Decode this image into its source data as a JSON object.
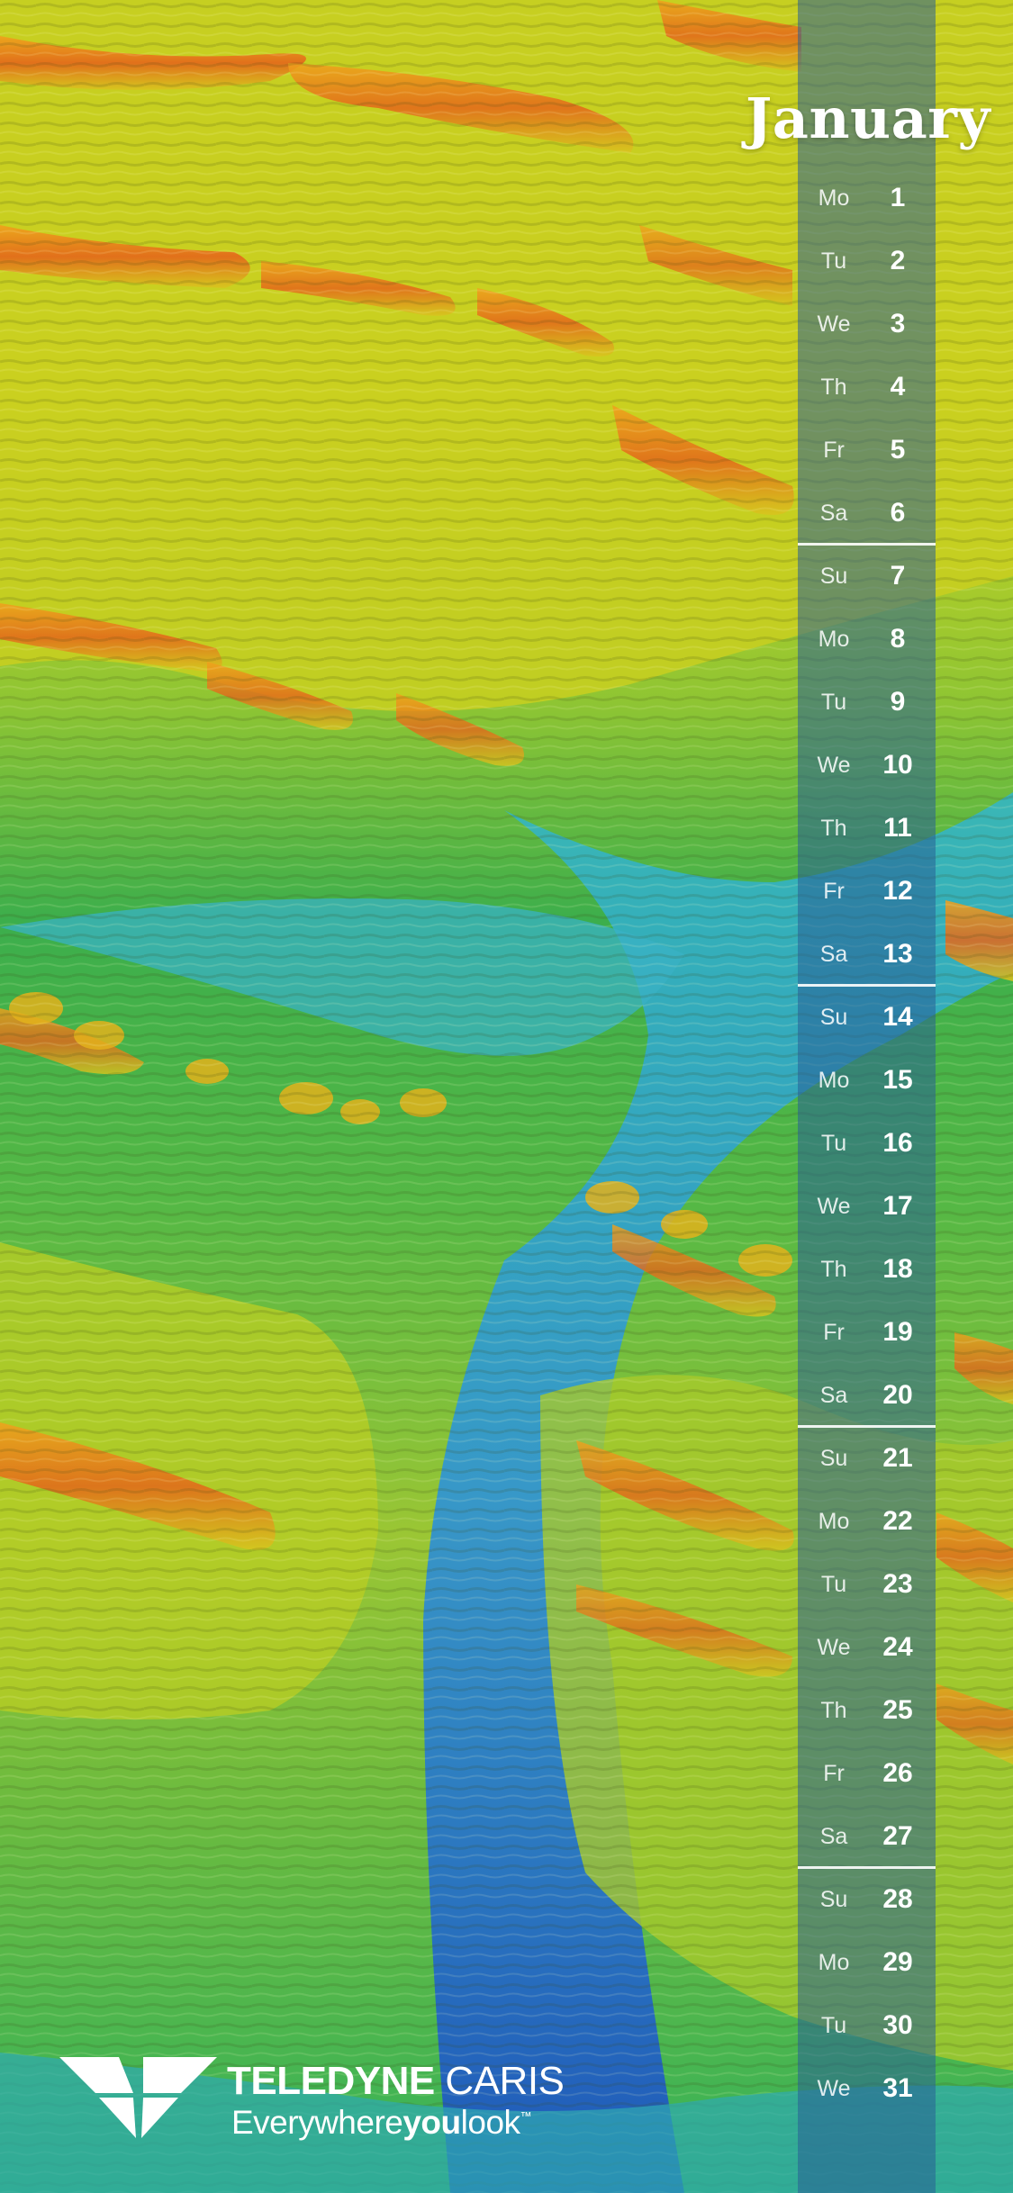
{
  "calendar": {
    "month": "January",
    "days": [
      {
        "dow": "Mo",
        "day": "1"
      },
      {
        "dow": "Tu",
        "day": "2"
      },
      {
        "dow": "We",
        "day": "3"
      },
      {
        "dow": "Th",
        "day": "4"
      },
      {
        "dow": "Fr",
        "day": "5"
      },
      {
        "dow": "Sa",
        "day": "6"
      },
      {
        "dow": "Su",
        "day": "7"
      },
      {
        "dow": "Mo",
        "day": "8"
      },
      {
        "dow": "Tu",
        "day": "9"
      },
      {
        "dow": "We",
        "day": "10"
      },
      {
        "dow": "Th",
        "day": "11"
      },
      {
        "dow": "Fr",
        "day": "12"
      },
      {
        "dow": "Sa",
        "day": "13"
      },
      {
        "dow": "Su",
        "day": "14"
      },
      {
        "dow": "Mo",
        "day": "15"
      },
      {
        "dow": "Tu",
        "day": "16"
      },
      {
        "dow": "We",
        "day": "17"
      },
      {
        "dow": "Th",
        "day": "18"
      },
      {
        "dow": "Fr",
        "day": "19"
      },
      {
        "dow": "Sa",
        "day": "20"
      },
      {
        "dow": "Su",
        "day": "21"
      },
      {
        "dow": "Mo",
        "day": "22"
      },
      {
        "dow": "Tu",
        "day": "23"
      },
      {
        "dow": "We",
        "day": "24"
      },
      {
        "dow": "Th",
        "day": "25"
      },
      {
        "dow": "Fr",
        "day": "26"
      },
      {
        "dow": "Sa",
        "day": "27"
      },
      {
        "dow": "Su",
        "day": "28"
      },
      {
        "dow": "Mo",
        "day": "29"
      },
      {
        "dow": "Tu",
        "day": "30"
      },
      {
        "dow": "We",
        "day": "31"
      }
    ]
  },
  "brand": {
    "name_bold": "TELEDYNE",
    "name_light": " CARIS",
    "tagline_start": "Everywhere",
    "tagline_bold": "you",
    "tagline_end": "look",
    "trademark": "™"
  },
  "colors": {
    "calendar_strip": "#285f96",
    "text": "#ffffff",
    "terrain_green": "#2fa84a",
    "terrain_yellow": "#d8d21e",
    "terrain_orange": "#e7761c",
    "terrain_blue": "#2a8fd6"
  }
}
